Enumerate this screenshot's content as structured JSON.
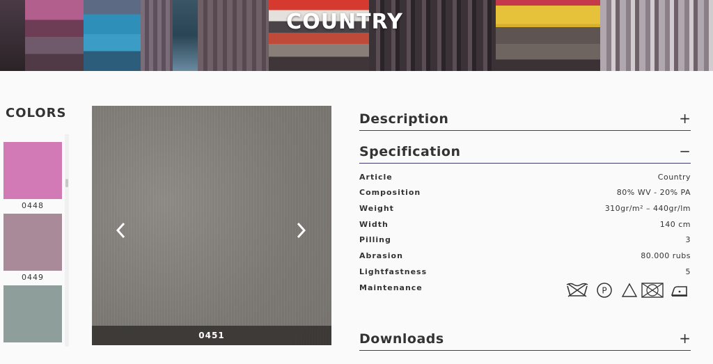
{
  "hero": {
    "title": "COUNTRY"
  },
  "sidebar": {
    "heading": "COLORS",
    "swatches": [
      {
        "code": "0448",
        "color": "#d27ab5"
      },
      {
        "code": "0449",
        "color": "#a88a98"
      },
      {
        "code": "",
        "color": "#8e9e9b"
      }
    ]
  },
  "gallery": {
    "caption": "0451",
    "prev_icon": "chevron-left-icon",
    "next_icon": "chevron-right-icon"
  },
  "sections": {
    "description": {
      "title": "Description",
      "toggle": "+"
    },
    "specification": {
      "title": "Specification",
      "toggle": "−"
    },
    "downloads": {
      "title": "Downloads",
      "toggle": "+"
    }
  },
  "specs": [
    {
      "label": "Article",
      "value": "Country"
    },
    {
      "label": "Composition",
      "value": "80% WV - 20% PA"
    },
    {
      "label": "Weight",
      "value": "310gr/m² – 440gr/lm"
    },
    {
      "label": "Width",
      "value": "140 cm"
    },
    {
      "label": "Pilling",
      "value": "3"
    },
    {
      "label": "Abrasion",
      "value": "80.000 rubs"
    },
    {
      "label": "Lightfastness",
      "value": "5"
    },
    {
      "label": "Maintenance",
      "value": ""
    }
  ],
  "care_icons": [
    "hand-wash-icon",
    "dry-clean-p-icon",
    "bleach-icon",
    "no-tumble-dry-icon",
    "iron-icon"
  ],
  "colors": {
    "accent_line": "#3d3a6e"
  }
}
